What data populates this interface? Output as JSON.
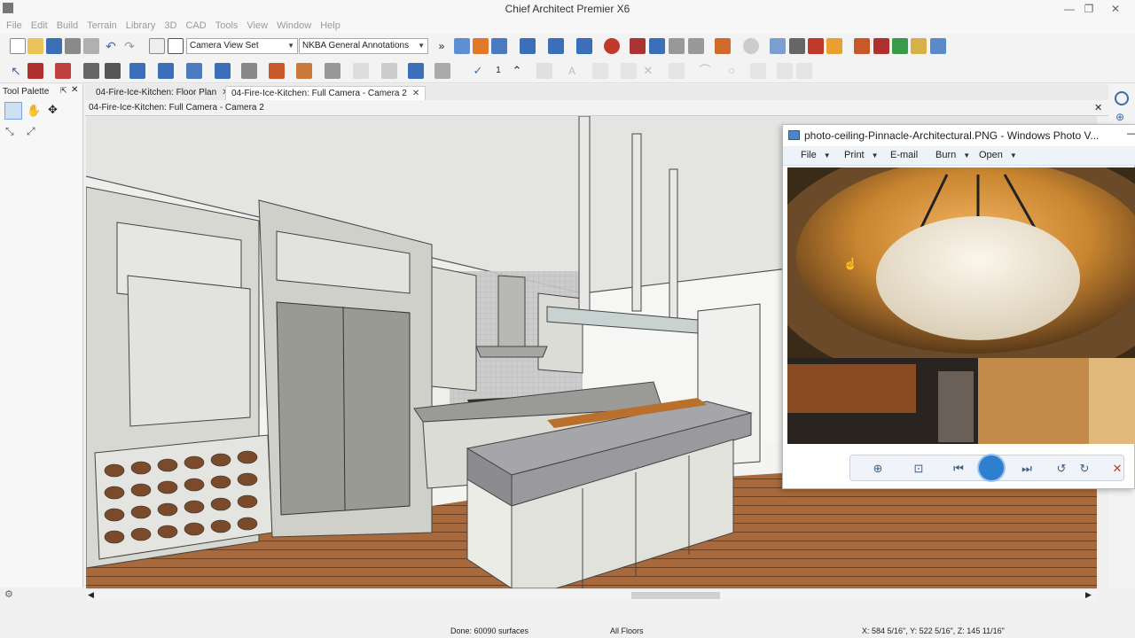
{
  "app": {
    "title": "Chief Architect Premier X6"
  },
  "window_controls": {
    "minimize": "—",
    "maximize": "❐",
    "close": "✕"
  },
  "menu": [
    "File",
    "Edit",
    "Build",
    "Terrain",
    "Library",
    "3D",
    "CAD",
    "Tools",
    "View",
    "Window",
    "Help"
  ],
  "toolbar": {
    "saved_plan_view": "Camera View Set",
    "annotation_set": "NKBA General Annotations",
    "overflow": "»"
  },
  "tool_palette": {
    "title": "Tool Palette"
  },
  "tabs": [
    {
      "label": "04-Fire-Ice-Kitchen: Floor Plan",
      "active": false
    },
    {
      "label": "04-Fire-Ice-Kitchen: Full Camera - Camera 2",
      "active": true
    }
  ],
  "view_label": "04-Fire-Ice-Kitchen: Full Camera - Camera 2",
  "status": {
    "message": "Done:  60090 surfaces",
    "floor": "All Floors",
    "coordinates": "X: 584 5/16\", Y: 522 5/16\", Z: 145 11/16\""
  },
  "photo_viewer": {
    "title": "photo-ceiling-Pinnacle-Architectural.PNG - Windows Photo V...",
    "menu": [
      {
        "label": "File",
        "dropdown": true
      },
      {
        "label": "Print",
        "dropdown": true
      },
      {
        "label": "E-mail",
        "dropdown": false
      },
      {
        "label": "Burn",
        "dropdown": true
      },
      {
        "label": "Open",
        "dropdown": true
      }
    ]
  },
  "colors": {
    "ribbon_accent": "#1f6fc5",
    "floor_wood": "#a8693c",
    "cabinet": "#d8d8d2",
    "ceiling_gold": "#c98530"
  }
}
